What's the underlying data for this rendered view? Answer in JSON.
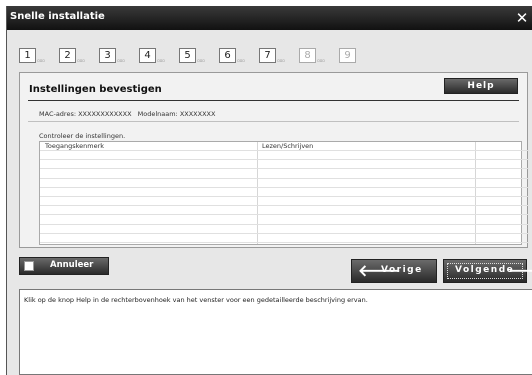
{
  "window": {
    "title": "Snelle installatie"
  },
  "steps": [
    {
      "label": "1",
      "enabled": true
    },
    {
      "label": "2",
      "enabled": true
    },
    {
      "label": "3",
      "enabled": true
    },
    {
      "label": "4",
      "enabled": true
    },
    {
      "label": "5",
      "enabled": true
    },
    {
      "label": "6",
      "enabled": true
    },
    {
      "label": "7",
      "enabled": true
    },
    {
      "label": "8",
      "enabled": false
    },
    {
      "label": "9",
      "enabled": false
    }
  ],
  "step_dots": "▫▫▫",
  "panel": {
    "title": "Instellingen bevestigen",
    "help_label": "Help",
    "mac_label": "MAC-adres: XXXXXXXXXXXX",
    "model_label": "Modelnaam: XXXXXXXX",
    "check_label": "Controleer de instellingen."
  },
  "table": {
    "columns": [
      "Toegangskenmerk",
      "Lezen/Schrijven",
      ""
    ],
    "rows": [
      [
        "",
        "",
        ""
      ],
      [
        "",
        "",
        ""
      ],
      [
        "",
        "",
        ""
      ],
      [
        "",
        "",
        ""
      ],
      [
        "",
        "",
        ""
      ],
      [
        "",
        "",
        ""
      ],
      [
        "",
        "",
        ""
      ],
      [
        "",
        "",
        ""
      ],
      [
        "",
        "",
        ""
      ],
      [
        "",
        "",
        ""
      ]
    ]
  },
  "buttons": {
    "cancel": "Annuleer",
    "prev": "Vorige",
    "next": "Volgende"
  },
  "icons": {
    "prev": "arrow-left-icon",
    "next": "arrow-right-icon",
    "close": "close-icon"
  },
  "description": "Klik op de knop Help in de rechterbovenhoek van het venster voor een gedetailleerde beschrijving ervan."
}
